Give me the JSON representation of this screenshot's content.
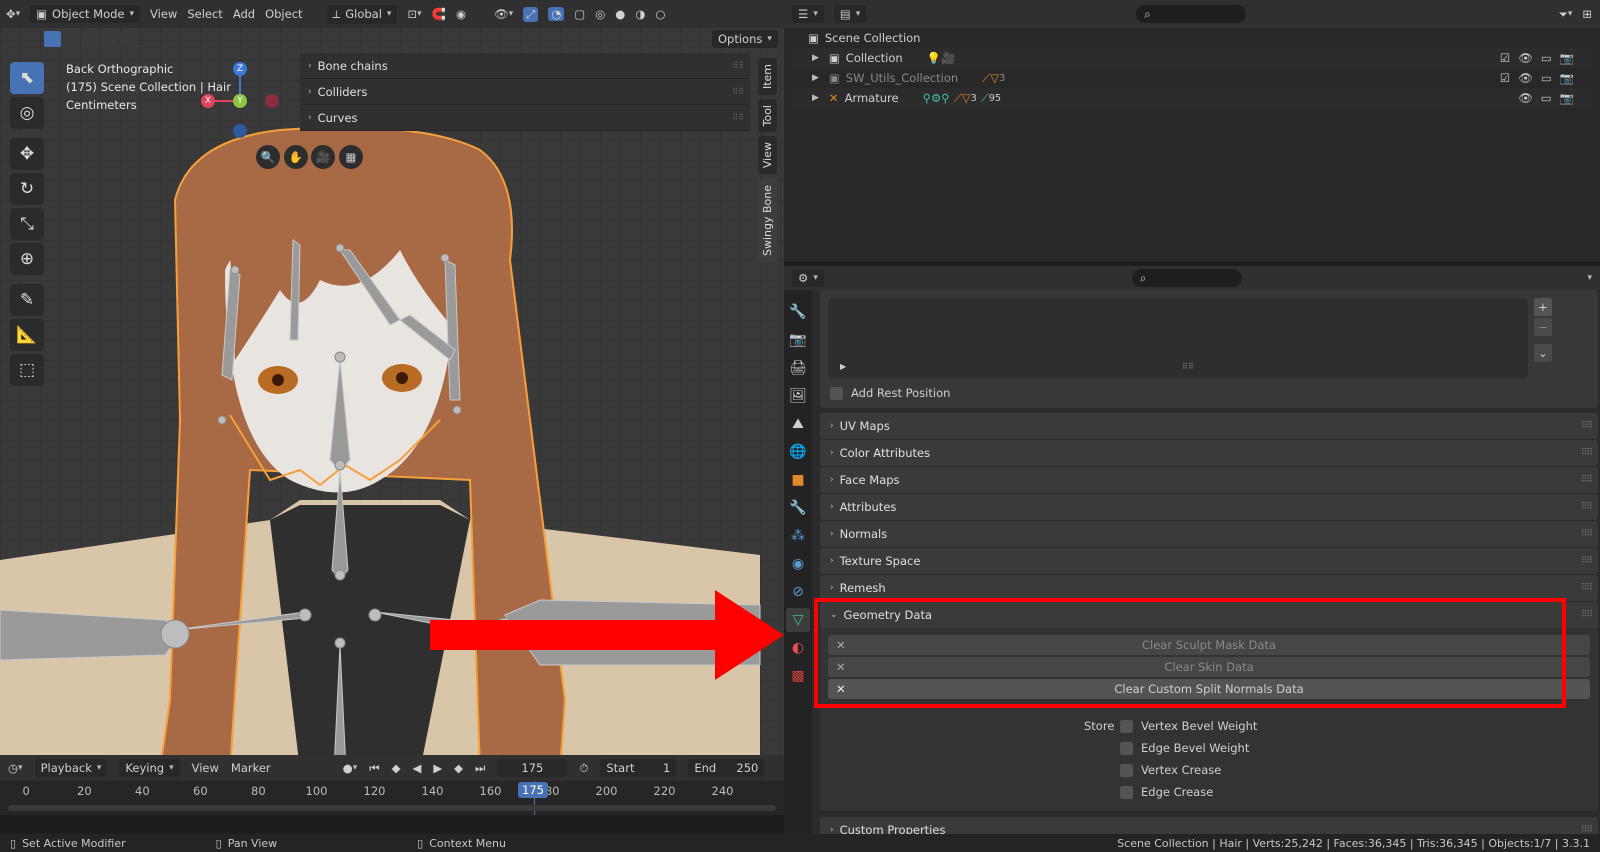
{
  "viewport_header": {
    "mode": "Object Mode",
    "menus": [
      "View",
      "Select",
      "Add",
      "Object"
    ],
    "orientation": "Global",
    "options": "Options"
  },
  "viewport_info": {
    "line1": "Back Orthographic",
    "line2": "(175) Scene Collection | Hair",
    "line3": "Centimeters"
  },
  "gizmo": {
    "z": "Z",
    "y": "Y",
    "x": "X"
  },
  "npanel": {
    "rows": [
      "Bone chains",
      "Colliders",
      "Curves"
    ],
    "tabs": [
      "Item",
      "Tool",
      "View",
      "Swingy Bone"
    ]
  },
  "timeline": {
    "menus": [
      "Playback",
      "Keying",
      "View",
      "Marker"
    ],
    "current_frame": "175",
    "start_label": "Start",
    "start": "1",
    "end_label": "End",
    "end": "250",
    "ticks": [
      "0",
      "20",
      "40",
      "60",
      "80",
      "100",
      "120",
      "140",
      "160",
      "180",
      "200",
      "220",
      "240"
    ],
    "playhead": "175"
  },
  "outliner": {
    "root": "Scene Collection",
    "items": [
      {
        "name": "Collection"
      },
      {
        "name": "SW_Utils_Collection",
        "badge": "3"
      },
      {
        "name": "Armature",
        "badge1": "3",
        "badge2": "95"
      }
    ]
  },
  "properties": {
    "add_rest_position": "Add Rest Position",
    "sections": [
      "UV Maps",
      "Color Attributes",
      "Face Maps",
      "Attributes",
      "Normals",
      "Texture Space",
      "Remesh"
    ],
    "geometry_data": {
      "title": "Geometry Data",
      "buttons": [
        "Clear Sculpt Mask Data",
        "Clear Skin Data",
        "Clear Custom Split Normals Data"
      ]
    },
    "store_label": "Store",
    "store_options": [
      "Vertex Bevel Weight",
      "Edge Bevel Weight",
      "Vertex Crease",
      "Edge Crease"
    ],
    "custom_properties": "Custom Properties"
  },
  "status_bar": {
    "left1": "Set Active Modifier",
    "left2": "Pan View",
    "left3": "Context Menu",
    "right": "Scene Collection | Hair | Verts:25,242 | Faces:36,345 | Tris:36,345 | Objects:1/7 | 3.3.1"
  },
  "colors": {
    "highlight": "#ff0000",
    "accent": "#4772b3",
    "selection_orange": "#f5a03a"
  }
}
